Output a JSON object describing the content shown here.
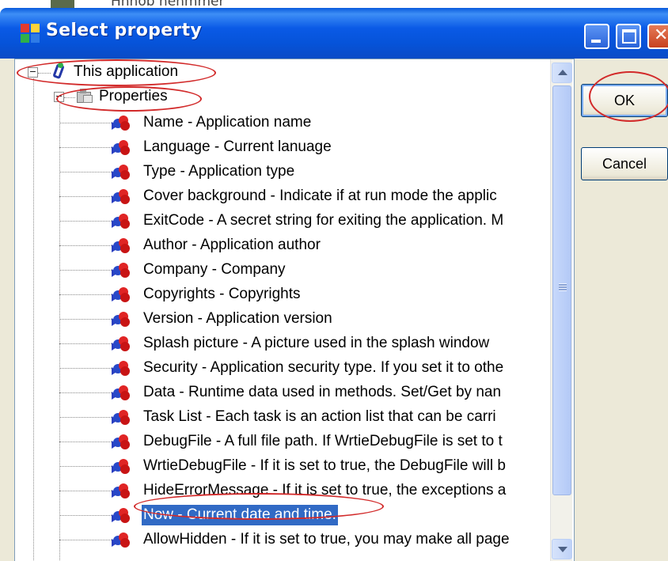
{
  "background": {
    "text": "Hnnob nenmmer"
  },
  "dialog": {
    "title": "Select property",
    "buttons": {
      "ok": "OK",
      "cancel": "Cancel"
    }
  },
  "tree": {
    "root": {
      "label": "This application",
      "expander": "−"
    },
    "group": {
      "label": "Properties",
      "expander": "−"
    },
    "items": [
      {
        "label": "Name - Application name"
      },
      {
        "label": "Language - Current lanuage"
      },
      {
        "label": "Type - Application type"
      },
      {
        "label": "Cover background - Indicate if at run mode the applic"
      },
      {
        "label": "ExitCode - A secret string for exiting the application. M"
      },
      {
        "label": "Author - Application author"
      },
      {
        "label": "Company - Company"
      },
      {
        "label": "Copyrights - Copyrights"
      },
      {
        "label": "Version - Application version"
      },
      {
        "label": "Splash picture - A picture used in the splash window"
      },
      {
        "label": "Security - Application security type. If you set it to othe"
      },
      {
        "label": "Data - Runtime data used in methods. Set/Get by nan"
      },
      {
        "label": "Task List - Each task is an action list that can be carri"
      },
      {
        "label": "DebugFile - A full file path. If WrtieDebugFile is set to t"
      },
      {
        "label": "WrtieDebugFile - If it is set to true, the DebugFile will b"
      },
      {
        "label": "HideErrorMessage - If it is set to true, the exceptions a"
      },
      {
        "label": "Now - Current date and time.",
        "selected": true
      },
      {
        "label": "AllowHidden - If it is set to true, you may make all page"
      }
    ]
  },
  "colors": {
    "selection": "#316ac5",
    "annotation": "#d22a2a",
    "titlebar": "#0a5ae6"
  }
}
